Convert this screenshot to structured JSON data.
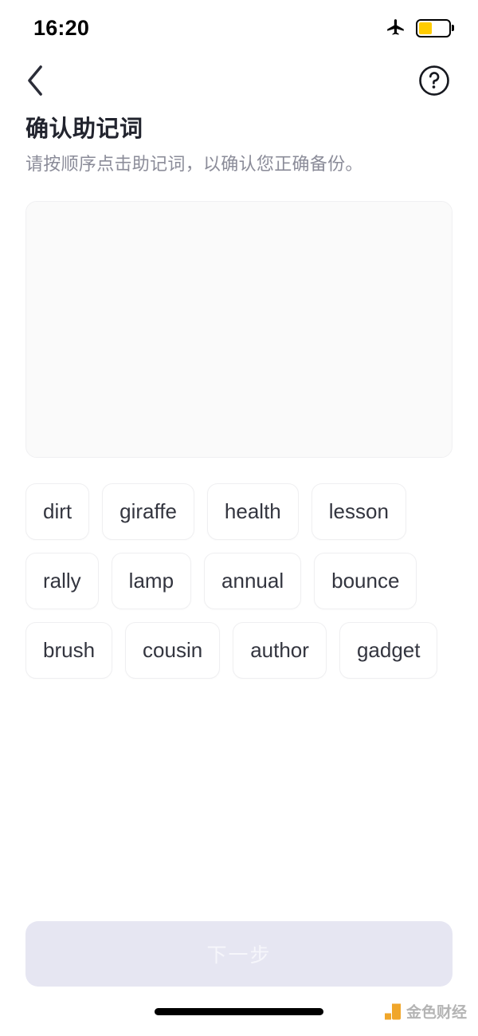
{
  "status_bar": {
    "time": "16:20",
    "airplane_icon": "airplane-mode-icon",
    "battery_icon": "battery-icon",
    "battery_level_percent": 45,
    "battery_color": "#ffcc00"
  },
  "nav_bar": {
    "back_icon": "chevron-left-icon",
    "help_icon": "question-mark-circle-icon"
  },
  "heading": {
    "title": "确认助记词",
    "subtitle": "请按顺序点击助记词，以确认您正确备份。"
  },
  "selected_box": {
    "selected_words": [],
    "background_color": "#fafafa"
  },
  "word_pool": {
    "words": [
      "dirt",
      "giraffe",
      "health",
      "lesson",
      "rally",
      "lamp",
      "annual",
      "bounce",
      "brush",
      "cousin",
      "author",
      "gadget"
    ]
  },
  "bottom": {
    "next_button_label": "下一步",
    "next_button_enabled": false,
    "next_button_color": "#e6e6f2"
  },
  "footer": {
    "home_indicator": "home-indicator",
    "watermark_text": "金色财经",
    "watermark_color": "#f0a62a"
  }
}
